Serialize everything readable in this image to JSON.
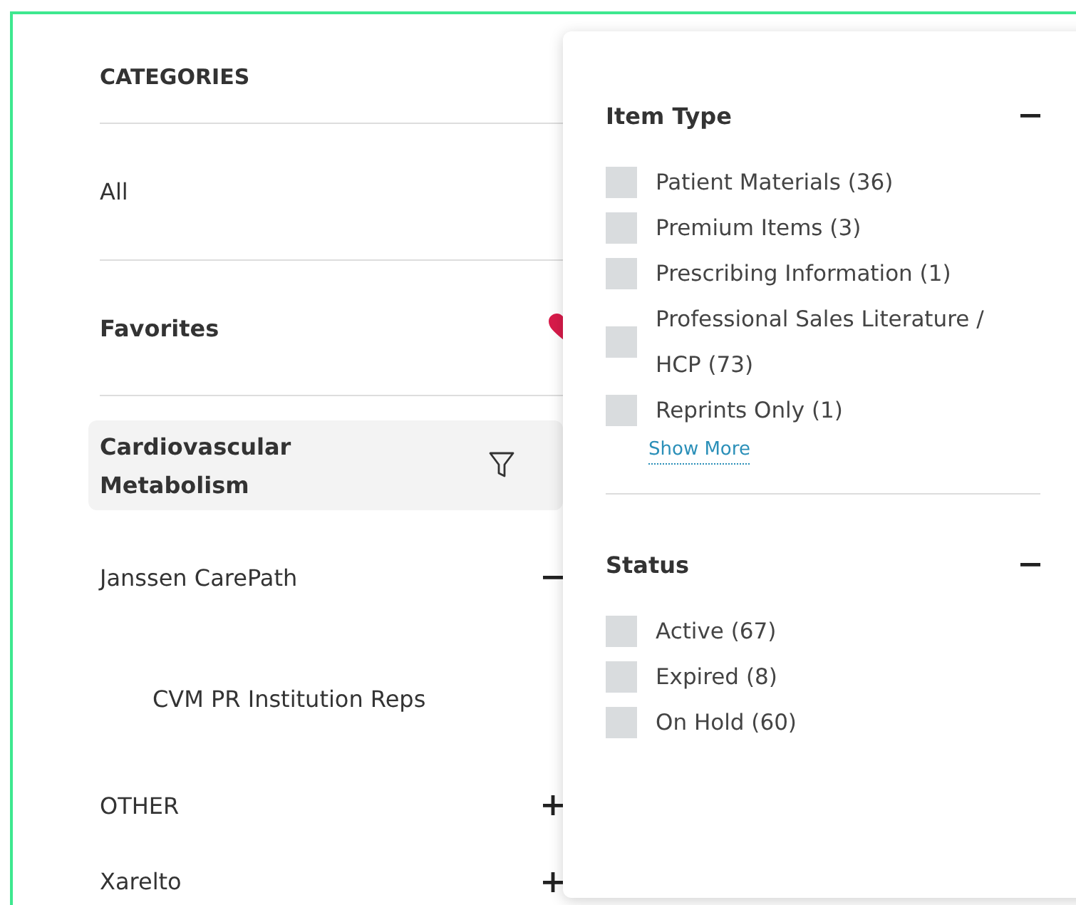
{
  "categories": {
    "title": "CATEGORIES",
    "items": [
      {
        "label": "All",
        "kind": "link",
        "selected": false
      },
      {
        "label": "Favorites",
        "kind": "favorites",
        "selected": false
      },
      {
        "label": "Cardiovascular Metabolism",
        "kind": "category",
        "selected": true
      },
      {
        "label": "Janssen CarePath",
        "kind": "group",
        "selected": false,
        "expanded": true,
        "children": [
          {
            "label": "CVM PR Institution Reps",
            "selected": false
          }
        ]
      },
      {
        "label": "OTHER",
        "kind": "group",
        "selected": false,
        "expanded": false
      },
      {
        "label": "Xarelto",
        "kind": "group",
        "selected": false,
        "expanded": false
      }
    ]
  },
  "filter_panel": {
    "sections": [
      {
        "title": "Item Type",
        "expanded": true,
        "options": [
          {
            "label": "Patient Materials (36)",
            "checked": false
          },
          {
            "label": "Premium Items (3)",
            "checked": false
          },
          {
            "label": "Prescribing Information (1)",
            "checked": false
          },
          {
            "label": "Professional Sales Literature / HCP (73)",
            "checked": false
          },
          {
            "label": "Reprints Only (1)",
            "checked": false
          }
        ],
        "show_more": "Show More"
      },
      {
        "title": "Status",
        "expanded": true,
        "options": [
          {
            "label": "Active (67)",
            "checked": false
          },
          {
            "label": "Expired (8)",
            "checked": false
          },
          {
            "label": "On Hold (60)",
            "checked": false
          }
        ]
      }
    ]
  }
}
